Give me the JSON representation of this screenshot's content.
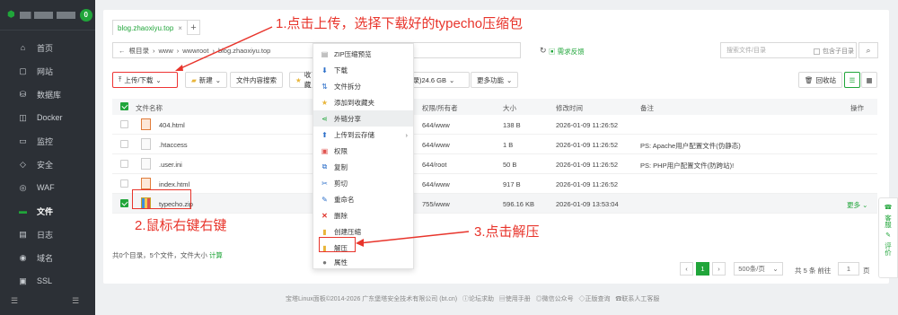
{
  "sidebar": {
    "badge": "0",
    "items": [
      {
        "label": "首页",
        "icon": "home-icon"
      },
      {
        "label": "网站",
        "icon": "globe-icon"
      },
      {
        "label": "数据库",
        "icon": "database-icon"
      },
      {
        "label": "Docker",
        "icon": "docker-icon"
      },
      {
        "label": "监控",
        "icon": "monitor-icon"
      },
      {
        "label": "安全",
        "icon": "shield-icon"
      },
      {
        "label": "WAF",
        "icon": "waf-icon"
      },
      {
        "label": "文件",
        "icon": "folder-icon"
      },
      {
        "label": "日志",
        "icon": "log-icon"
      },
      {
        "label": "域名",
        "icon": "domain-icon"
      },
      {
        "label": "SSL",
        "icon": "ssl-icon"
      }
    ]
  },
  "tab": {
    "label": "blog.zhaoxiyu.top"
  },
  "path": {
    "root": "根目录",
    "segments": [
      "www",
      "wwwroot",
      "blog.zhaoxiyu.top"
    ]
  },
  "toolbar": {
    "req": "需求反馈",
    "search_placeholder": "搜索文件/目录",
    "include_sub": "包含子目录",
    "upload": "上传/下载",
    "new": "新建",
    "content_search": "文件内容搜索",
    "fav": "收藏",
    "disk": "目录)24.6 GB",
    "more": "更多功能",
    "recycle": "回收站"
  },
  "table": {
    "headers": [
      "文件名称",
      "权限/所有者",
      "大小",
      "修改时间",
      "备注",
      "操作"
    ],
    "rows": [
      {
        "name": "404.html",
        "perm": "644/www",
        "size": "138 B",
        "time": "2026-01-09 11:26:52",
        "note": ""
      },
      {
        "name": ".htaccess",
        "perm": "644/www",
        "size": "1 B",
        "time": "2026-01-09 11:26:52",
        "note": "PS: Apache用户配置文件(伪静态)"
      },
      {
        "name": ".user.ini",
        "perm": "644/root",
        "size": "50 B",
        "time": "2026-01-09 11:26:52",
        "note": "PS: PHP用户配置文件(防跨站)!"
      },
      {
        "name": "index.html",
        "perm": "644/www",
        "size": "917 B",
        "time": "2026-01-09 11:26:52",
        "note": ""
      },
      {
        "name": "typecho.zip",
        "perm": "755/www",
        "size": "596.16 KB",
        "time": "2026-01-09 13:53:04",
        "note": "",
        "action": "更多"
      }
    ]
  },
  "footer": {
    "summary": "共0个目录，5个文件，文件大小",
    "calc": "计算",
    "page": "1",
    "per_page": "500条/页",
    "total": "共 5 条",
    "goto": "前往",
    "goto_val": "1",
    "page_unit": "页"
  },
  "copyright": "宝塔Linux面板©2014-2026 广东堡塔安全技术有限公司 (bt.cn)",
  "footer_links": [
    "论坛求助",
    "使用手册",
    "微信公众号",
    "正版查询",
    "联系人工客服"
  ],
  "context_menu": [
    "ZIP压缩预览",
    "下载",
    "文件拆分",
    "添加到收藏夹",
    "外链分享",
    "上传到云存储",
    "权限",
    "复制",
    "剪切",
    "重命名",
    "删除",
    "创建压缩",
    "解压",
    "属性"
  ],
  "annotations": {
    "step1": "1.点击上传，选择下载好的typecho压缩包",
    "step2": "2.鼠标右键右键",
    "step3": "3.点击解压"
  },
  "widget": {
    "service": "客服",
    "review": "评价"
  }
}
